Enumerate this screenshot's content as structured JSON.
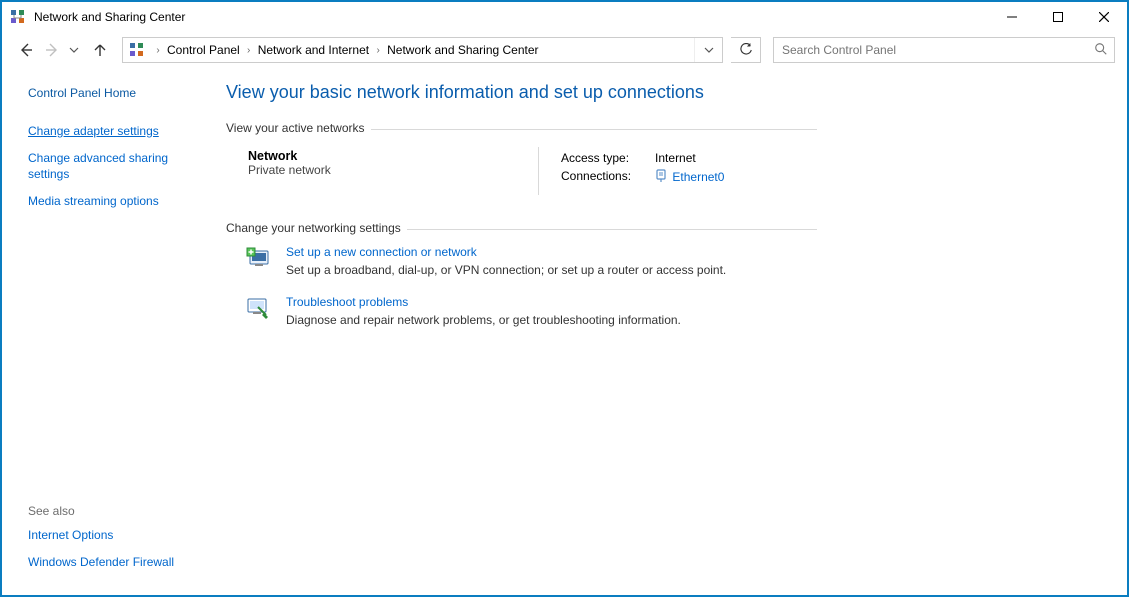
{
  "window": {
    "title": "Network and Sharing Center"
  },
  "breadcrumb": {
    "items": [
      "Control Panel",
      "Network and Internet",
      "Network and Sharing Center"
    ]
  },
  "search": {
    "placeholder": "Search Control Panel"
  },
  "sidebar": {
    "home": "Control Panel Home",
    "items": [
      {
        "label": "Change adapter settings",
        "selected": true
      },
      {
        "label": "Change advanced sharing settings",
        "selected": false
      },
      {
        "label": "Media streaming options",
        "selected": false
      }
    ],
    "see_also_label": "See also",
    "see_also": [
      {
        "label": "Internet Options"
      },
      {
        "label": "Windows Defender Firewall"
      }
    ]
  },
  "main": {
    "title": "View your basic network information and set up connections",
    "active_networks_label": "View your active networks",
    "network": {
      "name": "Network",
      "type": "Private network",
      "access_type_label": "Access type:",
      "access_type_value": "Internet",
      "connections_label": "Connections:",
      "connection_name": "Ethernet0"
    },
    "change_settings_label": "Change your networking settings",
    "actions": [
      {
        "title": "Set up a new connection or network",
        "desc": "Set up a broadband, dial-up, or VPN connection; or set up a router or access point."
      },
      {
        "title": "Troubleshoot problems",
        "desc": "Diagnose and repair network problems, or get troubleshooting information."
      }
    ]
  }
}
